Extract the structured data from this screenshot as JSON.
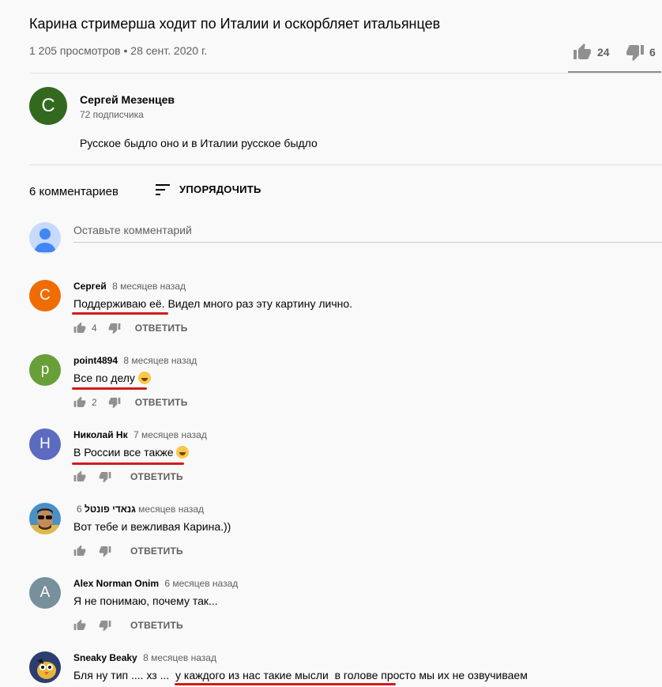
{
  "video": {
    "title": "Карина стримерша ходит по Италии и оскорбляет итальянцев",
    "views": "1 205 просмотров",
    "date": "28 сент. 2020 г.",
    "likes": "24",
    "dislikes": "6"
  },
  "channel": {
    "initial": "С",
    "name": "Сергей Мезенцев",
    "subscribers": "72 подписчика",
    "description": "Русское быдло оно и в Италии русское быдло"
  },
  "comments_header": {
    "count": "6 комментариев",
    "sort_label": "УПОРЯДОЧИТЬ",
    "input_placeholder": "Оставьте комментарий"
  },
  "reply_label": "ОТВЕТИТЬ",
  "separator": "•",
  "comments": [
    {
      "initial": "С",
      "avatar_color": "#ef6c00",
      "author": "Сергей",
      "time": "8 месяцев назад",
      "text": "Поддерживаю её. Видел много раз эту картину лично.",
      "likes": "4"
    },
    {
      "initial": "p",
      "avatar_color": "#689f38",
      "author": "point4894",
      "time": "8 месяцев назад",
      "text": "Все по делу",
      "likes": "2"
    },
    {
      "initial": "Н",
      "avatar_color": "#5c6bc0",
      "author": "Николай Нк",
      "time": "7 месяцев назад",
      "text": "В России все также",
      "likes": ""
    },
    {
      "initial": "",
      "avatar_color": "#4a90c8",
      "author": "גנאדי פונטל",
      "time": "6 месяцев назад",
      "text": "Вот тебе и вежливая Карина.))",
      "likes": ""
    },
    {
      "initial": "A",
      "avatar_color": "#78909c",
      "author": "Alex Norman Onim",
      "time": "6 месяцев назад",
      "text": "Я не понимаю, почему так...",
      "likes": ""
    },
    {
      "initial": "",
      "avatar_color": "#2c3e70",
      "author": "Sneaky Beaky",
      "time": "8 месяцев назад",
      "text": "Бля ну тип .... хз ...  у каждого из нас такие мысли  в голове просто мы их не озвучиваем",
      "likes": ""
    }
  ],
  "colors": {
    "background": "#f9f9f9",
    "underline_annotation": "#d01c1c",
    "channel_avatar": "#33691e"
  },
  "icons": [
    "thumb-up-icon",
    "thumb-down-icon",
    "sort-icon",
    "user-silhouette-icon",
    "laughing-emoji-icon"
  ]
}
